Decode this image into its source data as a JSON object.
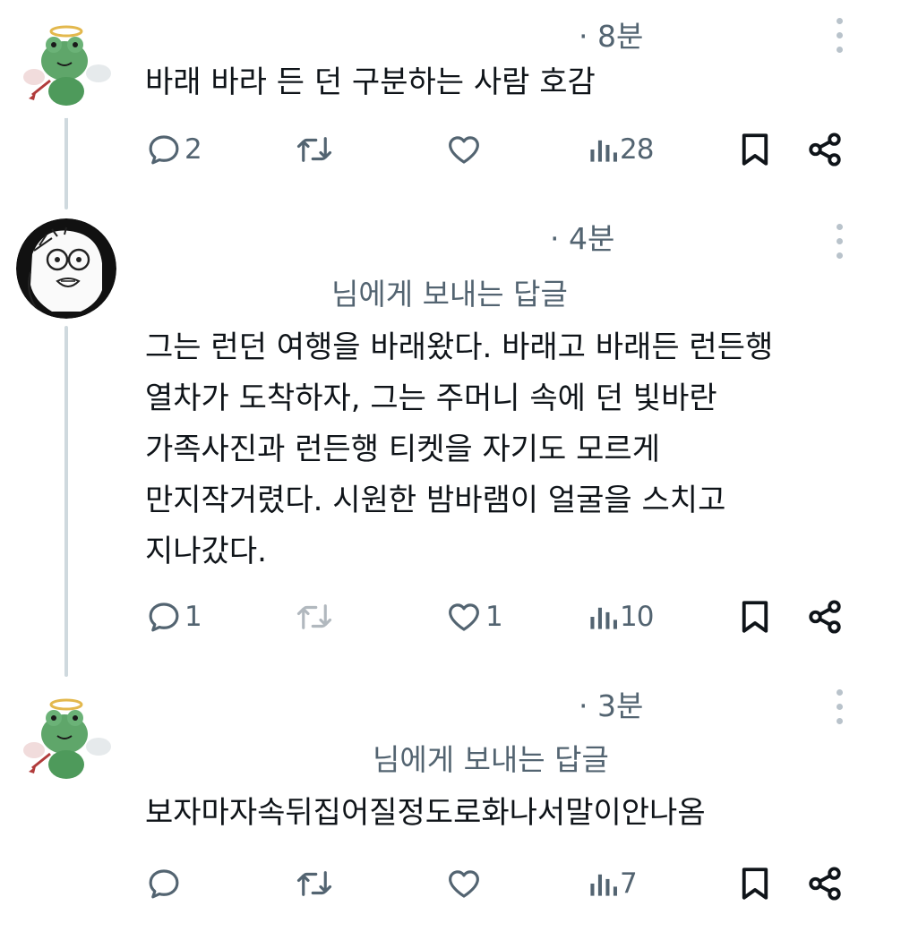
{
  "posts": [
    {
      "time": "· 8분",
      "text_lines": [
        "바래 바라 든 던 구분하는 사람 호감"
      ],
      "replies": "2",
      "reposts": "",
      "likes": "",
      "views": "28"
    },
    {
      "time": "· 4분",
      "reply_to": "님에게 보내는 답글",
      "text_lines": [
        "그는 런던 여행을 바래왔다. 바래고 바래든 런든행",
        "열차가 도착하자, 그는 주머니 속에 던 빛바란",
        "가족사진과 런든행 티켓을 자기도 모르게",
        "만지작거렸다. 시원한 밤바램이 얼굴을 스치고",
        "지나갔다."
      ],
      "replies": "1",
      "reposts": "",
      "likes": "1",
      "views": "10"
    },
    {
      "time": "· 3분",
      "reply_to": "님에게 보내는 답글",
      "text_lines": [
        "보자마자속뒤집어질정도로화나서말이안나옴"
      ],
      "replies": "",
      "reposts": "",
      "likes": "",
      "views": "7"
    }
  ],
  "icons": {
    "reply": "reply-icon",
    "repost": "repost-icon",
    "like": "like-icon",
    "views": "views-icon",
    "bookmark": "bookmark-icon",
    "share": "share-icon",
    "more": "more-vertical-icon"
  },
  "colors": {
    "text": "#0f1419",
    "muted": "#536471",
    "thread_line": "#cfd9de",
    "frog_green": "#5fa66a"
  }
}
